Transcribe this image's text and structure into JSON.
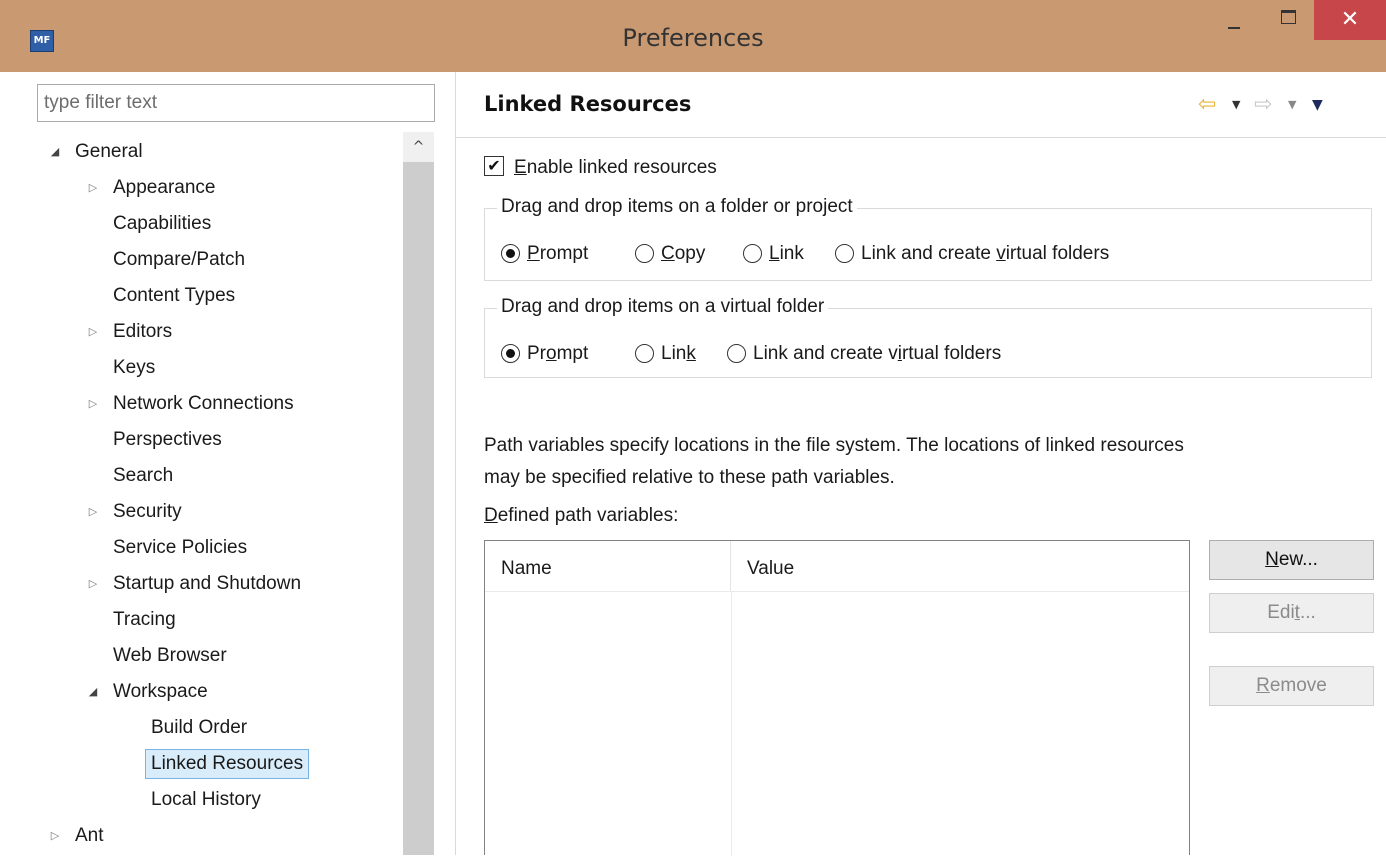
{
  "window": {
    "title": "Preferences",
    "icon_text": "MF",
    "close_symbol": "✕"
  },
  "filter": {
    "placeholder": "type filter text"
  },
  "tree": {
    "items": [
      {
        "label": "General",
        "state": "expanded"
      },
      {
        "label": "Appearance",
        "state": "collapsed"
      },
      {
        "label": "Capabilities",
        "state": "leaf"
      },
      {
        "label": "Compare/Patch",
        "state": "leaf"
      },
      {
        "label": "Content Types",
        "state": "leaf"
      },
      {
        "label": "Editors",
        "state": "collapsed"
      },
      {
        "label": "Keys",
        "state": "leaf"
      },
      {
        "label": "Network Connections",
        "state": "collapsed"
      },
      {
        "label": "Perspectives",
        "state": "leaf"
      },
      {
        "label": "Search",
        "state": "leaf"
      },
      {
        "label": "Security",
        "state": "collapsed"
      },
      {
        "label": "Service Policies",
        "state": "leaf"
      },
      {
        "label": "Startup and Shutdown",
        "state": "collapsed"
      },
      {
        "label": "Tracing",
        "state": "leaf"
      },
      {
        "label": "Web Browser",
        "state": "leaf"
      },
      {
        "label": "Workspace",
        "state": "expanded"
      },
      {
        "label": "Build Order",
        "state": "leaf"
      },
      {
        "label": "Linked Resources",
        "state": "leaf",
        "selected": true
      },
      {
        "label": "Local History",
        "state": "leaf"
      },
      {
        "label": "Ant",
        "state": "collapsed"
      }
    ],
    "expanded_arrow": "◢",
    "collapsed_arrow": "▷"
  },
  "page": {
    "title": "Linked Resources",
    "icons": {
      "back": "⇦",
      "forward": "⇨",
      "dropdown": "▼"
    }
  },
  "enable_checkbox": {
    "checked": true,
    "check_mark": "✔",
    "label_mnemonic": "E",
    "label_rest": "nable linked resources"
  },
  "group_folder": {
    "title": "Drag and drop items on a folder or project",
    "options": [
      {
        "pre": "",
        "mn": "P",
        "post": "rompt",
        "checked": true
      },
      {
        "pre": "",
        "mn": "C",
        "post": "opy",
        "checked": false
      },
      {
        "pre": "",
        "mn": "L",
        "post": "ink",
        "checked": false
      },
      {
        "pre": "Link and create ",
        "mn": "v",
        "post": "irtual folders",
        "checked": false
      }
    ]
  },
  "group_virtual": {
    "title": "Drag and drop items on a virtual folder",
    "options": [
      {
        "pre": "Pr",
        "mn": "o",
        "post": "mpt",
        "checked": true
      },
      {
        "pre": "Lin",
        "mn": "k",
        "post": "",
        "checked": false
      },
      {
        "pre": "Link and create v",
        "mn": "i",
        "post": "rtual folders",
        "checked": false
      }
    ]
  },
  "description": {
    "line1": "Path variables specify locations in the file system. The locations of linked resources",
    "line2": "may be specified relative to these path variables."
  },
  "defined_label": {
    "mn": "D",
    "rest": "efined path variables:"
  },
  "table": {
    "columns": [
      "Name",
      "Value"
    ],
    "rows": []
  },
  "buttons": {
    "new": {
      "mn": "N",
      "rest": "ew...",
      "enabled": true
    },
    "edit": {
      "pre": "Edi",
      "mn": "t",
      "rest": "...",
      "enabled": false
    },
    "remove": {
      "mn": "R",
      "rest": "emove",
      "enabled": false
    }
  },
  "scrollbar": {
    "up_symbol": "^"
  }
}
